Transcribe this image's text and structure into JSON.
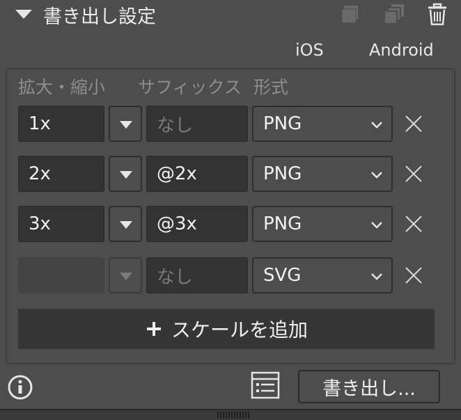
{
  "header": {
    "title": "書き出し設定"
  },
  "platforms": [
    "iOS",
    "Android"
  ],
  "columns": {
    "scale": "拡大・縮小",
    "suffix": "サフィックス",
    "format": "形式"
  },
  "rows": [
    {
      "scale": "1x",
      "suffix": "",
      "suffix_placeholder": "なし",
      "format": "PNG"
    },
    {
      "scale": "2x",
      "suffix": "@2x",
      "suffix_placeholder": "",
      "format": "PNG"
    },
    {
      "scale": "3x",
      "suffix": "@3x",
      "suffix_placeholder": "",
      "format": "PNG"
    },
    {
      "scale": "",
      "suffix": "",
      "suffix_placeholder": "なし",
      "format": "SVG"
    }
  ],
  "add_scale_label": "スケールを追加",
  "export_button_label": "書き出し...",
  "icons": {
    "collapse": "triangle-down-icon",
    "layer": "layer-icon",
    "layers": "layers-stack-icon",
    "trash": "trash-icon",
    "dropdown": "triangle-down-icon",
    "chevron": "chevron-down-icon",
    "remove": "close-icon",
    "add": "plus-icon",
    "info": "info-icon",
    "list": "list-view-icon"
  }
}
